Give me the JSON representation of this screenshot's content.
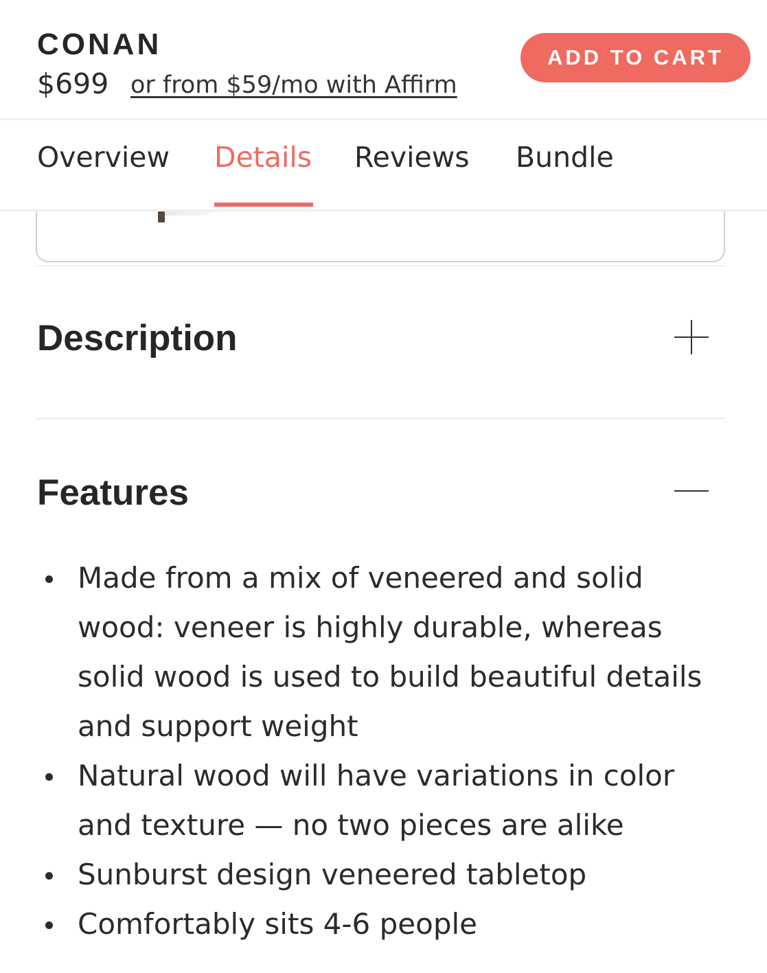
{
  "header": {
    "product_name": "CONAN",
    "price": "$699",
    "financing_link": "or from $59/mo with Affirm",
    "add_to_cart_label": "ADD TO CART"
  },
  "tabs": [
    {
      "label": "Overview",
      "active": false
    },
    {
      "label": "Details",
      "active": true
    },
    {
      "label": "Reviews",
      "active": false
    },
    {
      "label": "Bundle",
      "active": false
    }
  ],
  "sections": {
    "description": {
      "title": "Description",
      "expanded": false,
      "icon": "plus-icon"
    },
    "features": {
      "title": "Features",
      "expanded": true,
      "icon": "minus-icon",
      "items": [
        "Made from a mix of veneered and solid wood: veneer is highly durable, whereas solid wood is used to build beautiful details and support weight",
        "Natural wood will have variations in color and texture — no two pieces are alike",
        "Sunburst design veneered tabletop",
        "Comfortably sits 4-6 people"
      ]
    }
  },
  "colors": {
    "accent": "#ef6a60",
    "text": "#2b2b2b",
    "divider": "#efefef"
  }
}
